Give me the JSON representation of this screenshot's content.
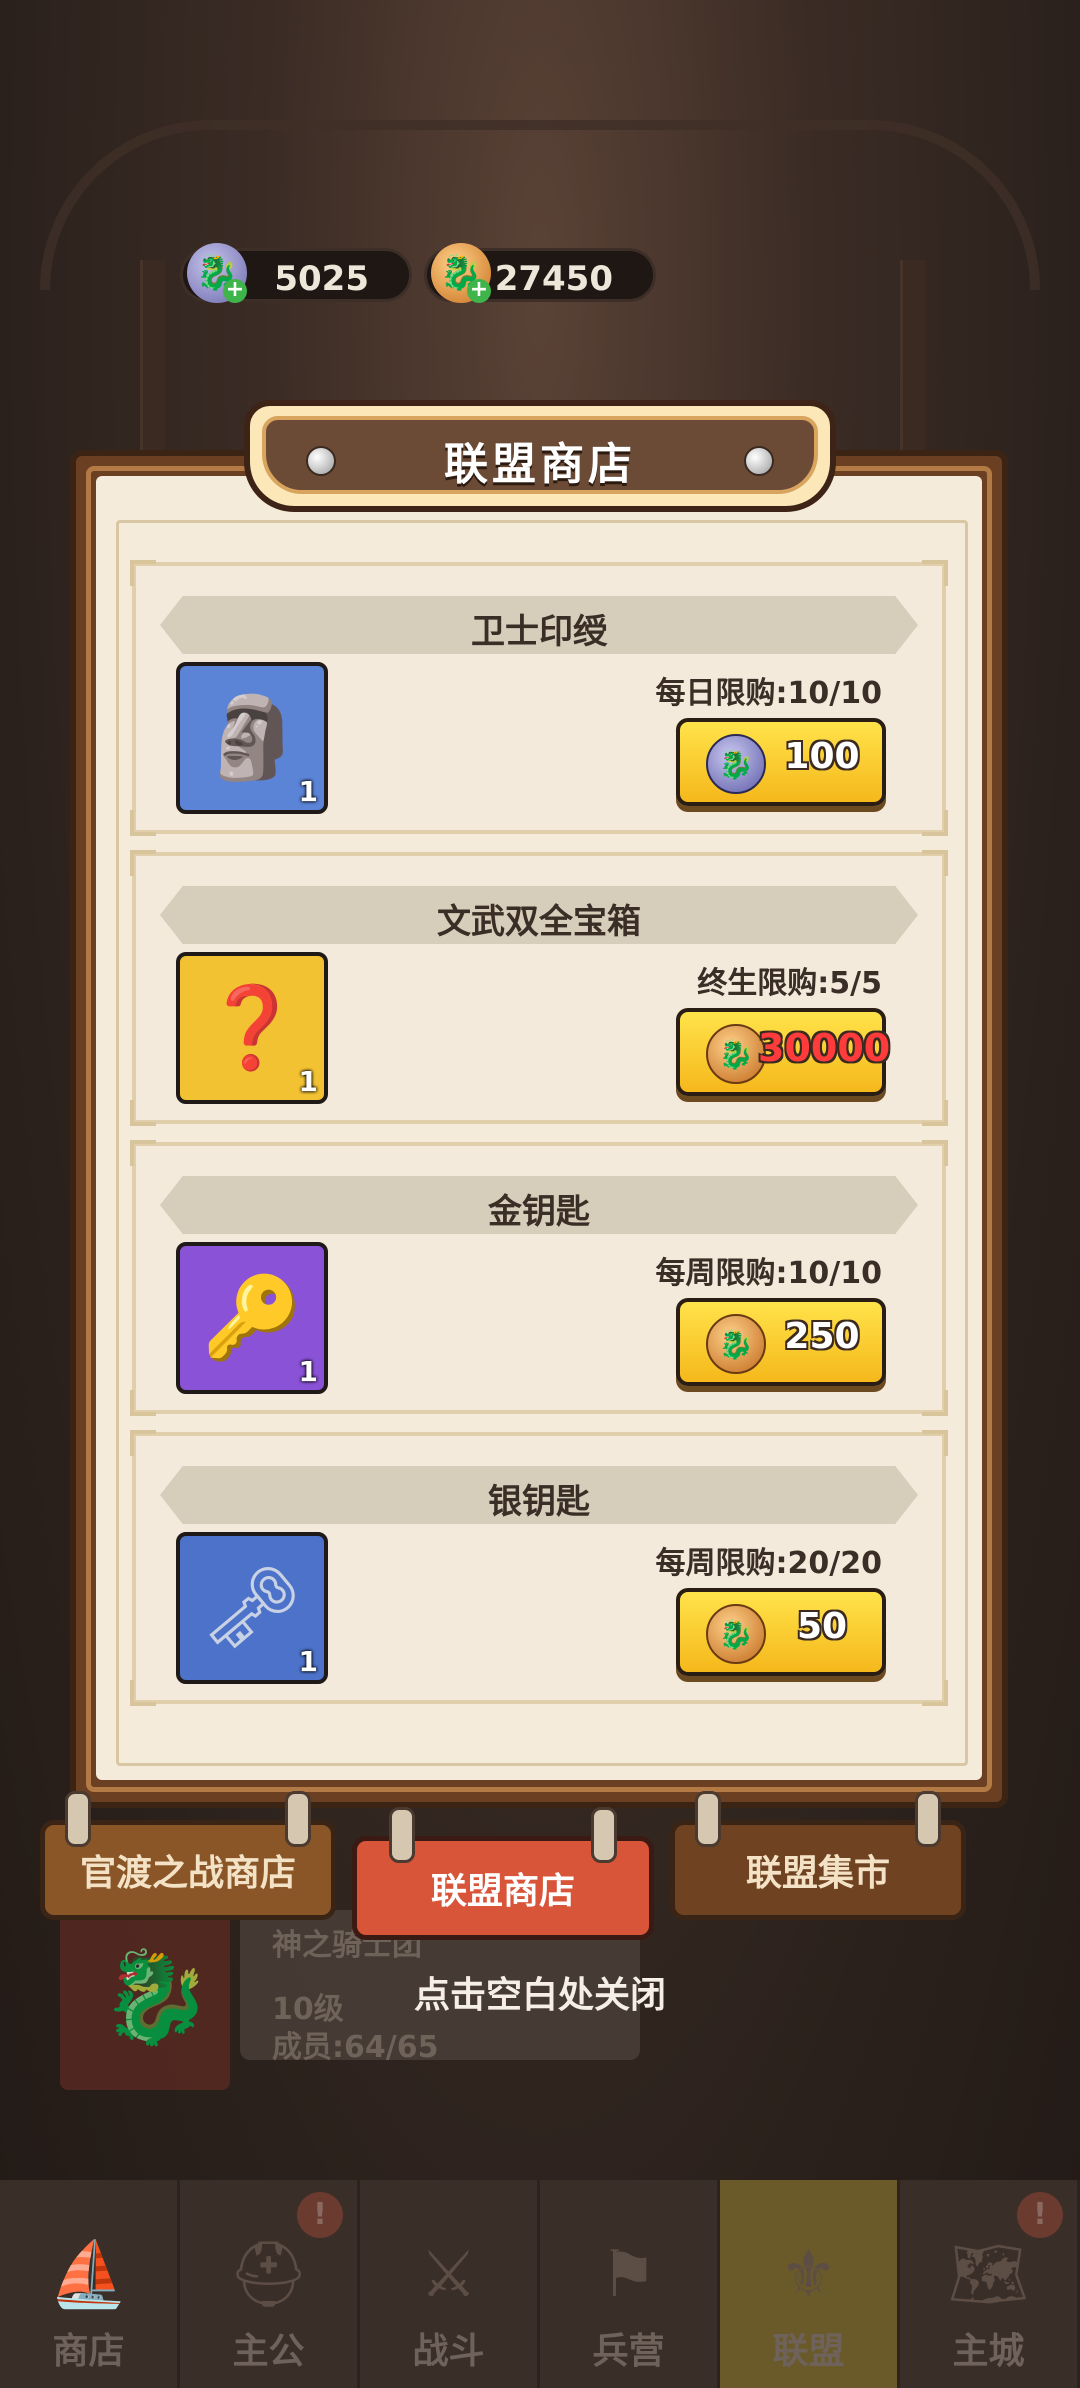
{
  "currencies": [
    {
      "name": "alliance-silver-coin",
      "value": "5025",
      "icon": "silver-dragon-coin-icon"
    },
    {
      "name": "alliance-gold-coin",
      "value": "27450",
      "icon": "gold-dragon-coin-icon"
    }
  ],
  "shop": {
    "title": "联盟商店",
    "items": [
      {
        "name": "卫士印绶",
        "limit": "每日限购:10/10",
        "qty": "1",
        "price": "100",
        "currency": "silver",
        "icon": "jade-seal-icon",
        "color": "#5b83d6"
      },
      {
        "name": "文武双全宝箱",
        "limit": "终生限购:5/5",
        "qty": "1",
        "price": "30000",
        "currency": "gold",
        "insufficient": true,
        "icon": "mystery-chest-icon",
        "color": "#f2c232"
      },
      {
        "name": "金钥匙",
        "limit": "每周限购:10/10",
        "qty": "1",
        "price": "250",
        "currency": "gold",
        "icon": "gold-key-icon",
        "color": "#8a52d6"
      },
      {
        "name": "银钥匙",
        "limit": "每周限购:20/20",
        "qty": "1",
        "price": "50",
        "currency": "gold",
        "icon": "silver-key-icon",
        "color": "#4d72c9"
      }
    ]
  },
  "tabs": [
    {
      "label": "官渡之战商店",
      "active": false
    },
    {
      "label": "联盟商店",
      "active": true
    },
    {
      "label": "联盟集市",
      "active": false
    }
  ],
  "close_hint": "点击空白处关闭",
  "background": {
    "guild_name": "神之骑士团",
    "guild_level": "10级",
    "guild_members": "成员:64/65",
    "nav": [
      {
        "label": "商店",
        "alert": false
      },
      {
        "label": "主公",
        "alert": true
      },
      {
        "label": "战斗",
        "alert": false
      },
      {
        "label": "兵营",
        "alert": false
      },
      {
        "label": "联盟",
        "alert": false,
        "active": true
      },
      {
        "label": "主城",
        "alert": true
      }
    ]
  }
}
